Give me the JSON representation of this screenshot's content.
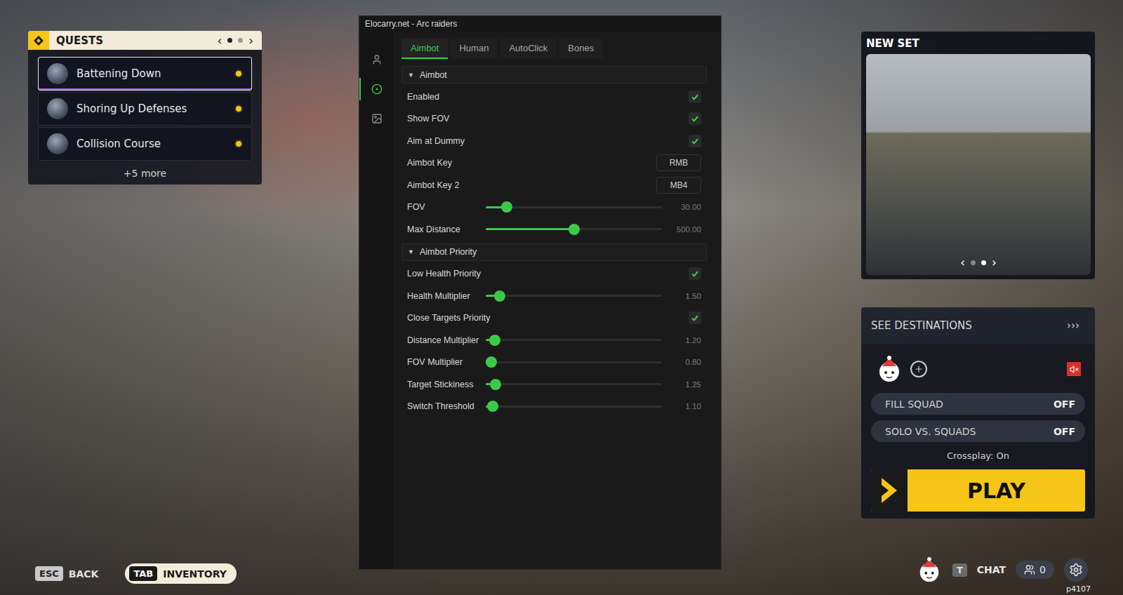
{
  "quests": {
    "title": "QUESTS",
    "pager": {
      "prev": "‹",
      "next": "›",
      "pages": [
        {
          "selected": true
        },
        {
          "selected": false
        }
      ]
    },
    "items": [
      {
        "name": "Battening Down",
        "selected": true
      },
      {
        "name": "Shoring Up Defenses",
        "selected": false
      },
      {
        "name": "Collision Course",
        "selected": false
      }
    ],
    "more": "+5 more"
  },
  "menu": {
    "title": "Elocarry.net - Arc raiders",
    "sidebar": [
      {
        "selected": false
      },
      {
        "selected": true
      },
      {
        "selected": false
      }
    ],
    "tabs": [
      {
        "label": "Aimbot",
        "selected": true
      },
      {
        "label": "Human",
        "selected": false
      },
      {
        "label": "AutoClick",
        "selected": false
      },
      {
        "label": "Bones",
        "selected": false
      }
    ],
    "sections": [
      {
        "title": "Aimbot",
        "caret": "▼",
        "expanded": true,
        "rows": [
          {
            "kind": "checkbox",
            "label": "Enabled",
            "checked": true
          },
          {
            "kind": "checkbox",
            "label": "Show FOV",
            "checked": true
          },
          {
            "kind": "checkbox",
            "label": "Aim at Dummy",
            "checked": true
          },
          {
            "kind": "key",
            "label": "Aimbot Key",
            "value": "RMB"
          },
          {
            "kind": "key",
            "label": "Aimbot Key 2",
            "value": "MB4"
          },
          {
            "kind": "slider",
            "label": "FOV",
            "level": 0.12,
            "reading": "30.00"
          },
          {
            "kind": "slider",
            "label": "Max Distance",
            "level": 0.5,
            "reading": "500.00"
          }
        ]
      },
      {
        "title": "Aimbot Priority",
        "caret": "▼",
        "expanded": true,
        "rows": [
          {
            "kind": "checkbox",
            "label": "Low Health Priority",
            "checked": true
          },
          {
            "kind": "slider",
            "label": "Health Multiplier",
            "level": 0.08,
            "reading": "1.50"
          },
          {
            "kind": "checkbox",
            "label": "Close Targets Priority",
            "checked": true
          },
          {
            "kind": "slider",
            "label": "Distance Multiplier",
            "level": 0.05,
            "reading": "1.20"
          },
          {
            "kind": "slider",
            "label": "FOV Multiplier",
            "level": 0.03,
            "reading": "0.80"
          },
          {
            "kind": "slider",
            "label": "Target Stickiness",
            "level": 0.055,
            "reading": "1.25"
          },
          {
            "kind": "slider",
            "label": "Switch Threshold",
            "level": 0.04,
            "reading": "1.10"
          }
        ]
      }
    ]
  },
  "newSet": {
    "title": "NEW SET",
    "pager": {
      "prev": "‹",
      "next": "›",
      "pages": [
        {
          "selected": false
        },
        {
          "selected": true
        }
      ]
    }
  },
  "destinations": {
    "label": "SEE DESTINATIONS",
    "arrows": "›››"
  },
  "toggles": [
    {
      "label": "FILL SQUAD",
      "value": "OFF",
      "on": false
    },
    {
      "label": "SOLO VS. SQUADS",
      "value": "OFF",
      "on": false
    }
  ],
  "crossplay": "Crossplay: On",
  "play": "PLAY",
  "hints": [
    {
      "key": "ESC",
      "label": "BACK",
      "highlighted": false
    },
    {
      "key": "TAB",
      "label": "INVENTORY",
      "highlighted": true
    }
  ],
  "bottomBar": {
    "chatKey": "T",
    "chat": "CHAT",
    "friends": "0"
  },
  "build": "p4107"
}
